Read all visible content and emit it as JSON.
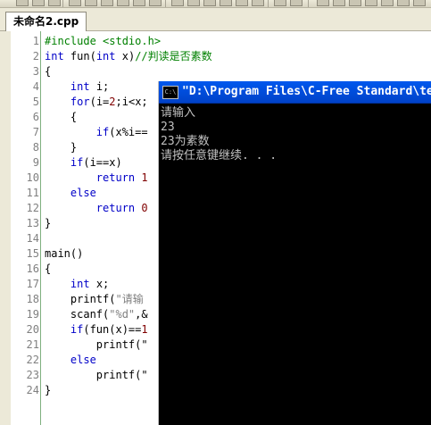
{
  "tab": {
    "title": "未命名2.cpp"
  },
  "editor": {
    "lines": [
      {
        "num": "1",
        "segs": [
          [
            "d",
            "#include <stdio.h>"
          ]
        ]
      },
      {
        "num": "2",
        "segs": [
          [
            "k",
            "int"
          ],
          [
            "p",
            " fun("
          ],
          [
            "k",
            "int"
          ],
          [
            "p",
            " x)"
          ],
          [
            "c",
            "//判读是否素数"
          ]
        ]
      },
      {
        "num": "3",
        "segs": [
          [
            "p",
            "{"
          ]
        ]
      },
      {
        "num": "4",
        "segs": [
          [
            "p",
            "    "
          ],
          [
            "k",
            "int"
          ],
          [
            "p",
            " i;"
          ]
        ]
      },
      {
        "num": "5",
        "segs": [
          [
            "p",
            "    "
          ],
          [
            "k",
            "for"
          ],
          [
            "p",
            "(i="
          ],
          [
            "n",
            "2"
          ],
          [
            "p",
            ";i<x;"
          ]
        ]
      },
      {
        "num": "6",
        "segs": [
          [
            "p",
            "    {"
          ]
        ]
      },
      {
        "num": "7",
        "segs": [
          [
            "p",
            "        "
          ],
          [
            "k",
            "if"
          ],
          [
            "p",
            "(x%i=="
          ]
        ]
      },
      {
        "num": "8",
        "segs": [
          [
            "p",
            "    }"
          ]
        ]
      },
      {
        "num": "9",
        "segs": [
          [
            "p",
            "    "
          ],
          [
            "k",
            "if"
          ],
          [
            "p",
            "(i==x)"
          ]
        ]
      },
      {
        "num": "10",
        "segs": [
          [
            "p",
            "        "
          ],
          [
            "k",
            "return"
          ],
          [
            "p",
            " "
          ],
          [
            "n",
            "1"
          ]
        ]
      },
      {
        "num": "11",
        "segs": [
          [
            "p",
            "    "
          ],
          [
            "k",
            "else"
          ]
        ]
      },
      {
        "num": "12",
        "segs": [
          [
            "p",
            "        "
          ],
          [
            "k",
            "return"
          ],
          [
            "p",
            " "
          ],
          [
            "n",
            "0"
          ]
        ]
      },
      {
        "num": "13",
        "segs": [
          [
            "p",
            "}"
          ]
        ]
      },
      {
        "num": "14",
        "segs": []
      },
      {
        "num": "15",
        "segs": [
          [
            "p",
            "main()"
          ]
        ]
      },
      {
        "num": "16",
        "segs": [
          [
            "p",
            "{"
          ]
        ]
      },
      {
        "num": "17",
        "segs": [
          [
            "p",
            "    "
          ],
          [
            "k",
            "int"
          ],
          [
            "p",
            " x;"
          ]
        ]
      },
      {
        "num": "18",
        "segs": [
          [
            "p",
            "    printf("
          ],
          [
            "s",
            "\"请输"
          ]
        ]
      },
      {
        "num": "19",
        "segs": [
          [
            "p",
            "    scanf("
          ],
          [
            "s",
            "\"%d\""
          ],
          [
            "p",
            ",&"
          ]
        ]
      },
      {
        "num": "20",
        "segs": [
          [
            "p",
            "    "
          ],
          [
            "k",
            "if"
          ],
          [
            "p",
            "(fun(x)=="
          ],
          [
            "n",
            "1"
          ]
        ]
      },
      {
        "num": "21",
        "segs": [
          [
            "p",
            "        printf(\""
          ]
        ]
      },
      {
        "num": "22",
        "segs": [
          [
            "p",
            "    "
          ],
          [
            "k",
            "else"
          ]
        ]
      },
      {
        "num": "23",
        "segs": [
          [
            "p",
            "        printf(\""
          ]
        ]
      },
      {
        "num": "24",
        "segs": [
          [
            "p",
            "}"
          ]
        ]
      }
    ]
  },
  "console": {
    "icon_text": "C:\\",
    "title": "\"D:\\Program Files\\C-Free Standard\\te",
    "output": [
      "请输入",
      "23",
      "23为素数",
      "请按任意键继续. . ."
    ]
  },
  "colors": {
    "keyword": "#0000c8",
    "directive": "#008000",
    "comment": "#008000",
    "string": "#808080",
    "number": "#800000",
    "console_title": "#0054e3",
    "console_bg": "#000000",
    "console_text": "#c0c0c0"
  }
}
